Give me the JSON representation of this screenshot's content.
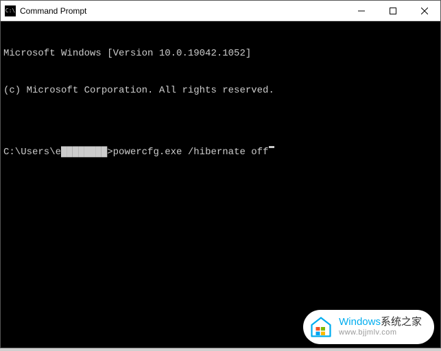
{
  "titlebar": {
    "icon_label": "C:\\",
    "title": "Command Prompt"
  },
  "terminal": {
    "line1": "Microsoft Windows [Version 10.0.19042.1052]",
    "line2": "(c) Microsoft Corporation. All rights reserved.",
    "blank": "",
    "prompt_prefix": "C:\\Users\\e",
    "prompt_suffix": ">",
    "command": "powercfg.exe /hibernate off"
  },
  "watermark": {
    "brand_prefix": "Windows",
    "brand_suffix": "系统之家",
    "url": "www.bjjmlv.com"
  }
}
